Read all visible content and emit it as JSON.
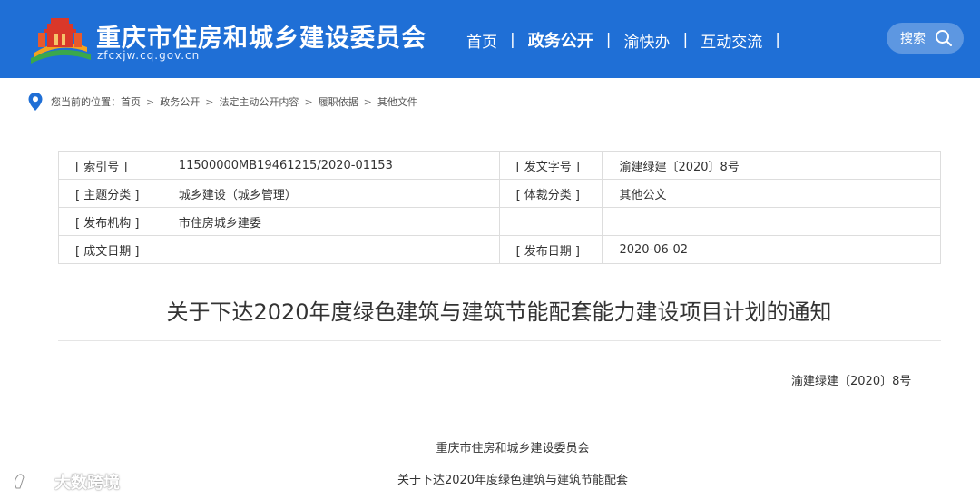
{
  "header": {
    "site_title": "重庆市住房和城乡建设委员会",
    "site_domain": "zfcxjw.cq.gov.cn",
    "nav": [
      {
        "label": "首页"
      },
      {
        "label": "政务公开"
      },
      {
        "label": "渝快办"
      },
      {
        "label": "互动交流"
      }
    ],
    "nav_separator": "|",
    "search_label": "搜索",
    "colors": {
      "bar": "#1f6fd6",
      "logo_red": "#d9382a",
      "logo_orange": "#f4a21e",
      "logo_green": "#3aa84c"
    }
  },
  "breadcrumb": {
    "prefix": "您当前的位置：",
    "items": [
      "首页",
      "政务公开",
      "法定主动公开内容",
      "履职依据",
      "其他文件"
    ],
    "separator": ">"
  },
  "meta": {
    "rows": [
      {
        "l1": "[ 索引号 ]",
        "v1": "11500000MB19461215/2020-01153",
        "l2": "[ 发文字号 ]",
        "v2": "渝建绿建〔2020〕8号"
      },
      {
        "l1": "[ 主题分类 ]",
        "v1": "城乡建设（城乡管理）",
        "l2": "[ 体裁分类 ]",
        "v2": "其他公文"
      },
      {
        "l1": "[ 发布机构 ]",
        "v1": "市住房城乡建委",
        "l2": "",
        "v2": ""
      },
      {
        "l1": "[ 成文日期 ]",
        "v1": "",
        "l2": "[ 发布日期 ]",
        "v2": "2020-06-02"
      }
    ]
  },
  "document": {
    "title": "关于下达2020年度绿色建筑与建筑节能配套能力建设项目计划的通知",
    "number": "渝建绿建〔2020〕8号",
    "line1": "重庆市住房和城乡建设委员会",
    "line2": "关于下达2020年度绿色建筑与建筑节能配套"
  },
  "watermark": {
    "text": "大数跨境"
  }
}
